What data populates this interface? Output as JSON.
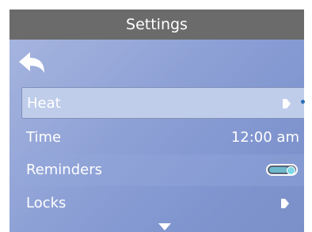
{
  "header": {
    "title": "Settings"
  },
  "navigation": {
    "back_icon": "back-arrow-icon"
  },
  "menu": {
    "items": [
      {
        "label": "Heat",
        "value": "",
        "control": "chevron-right-icon",
        "selected": true
      },
      {
        "label": "Time",
        "value": "12:00 am",
        "control": "",
        "selected": false
      },
      {
        "label": "Reminders",
        "value": "",
        "control": "toggle-switch",
        "toggle_on": true,
        "selected": false
      },
      {
        "label": "Locks",
        "value": "",
        "control": "chevron-right-icon",
        "selected": false
      }
    ],
    "more_indicator_icon": "scroll-down-arrow-icon"
  },
  "colors": {
    "title_bar": "#6b6b6b",
    "background": "#8ea1d6",
    "selected_row": "#bfcdea",
    "text": "#ffffff",
    "scroll_indicator": "#2a6fb8"
  }
}
